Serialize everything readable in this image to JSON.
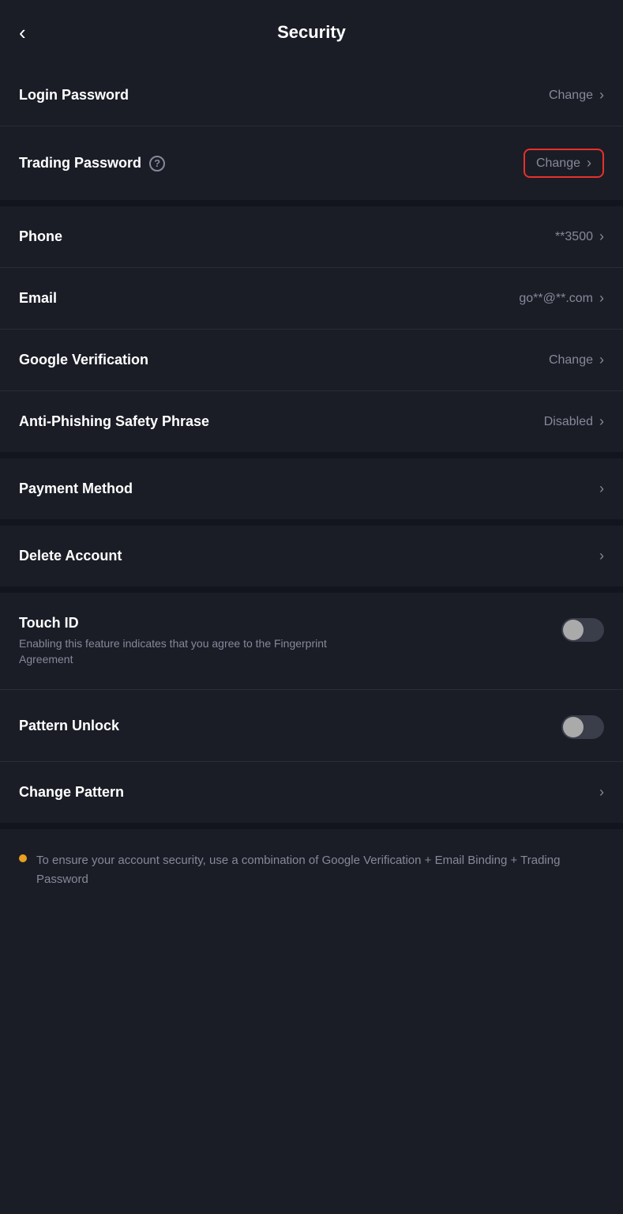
{
  "header": {
    "title": "Security",
    "back_label": "<"
  },
  "sections": {
    "passwords": [
      {
        "id": "login-password",
        "label": "Login Password",
        "action": "Change",
        "highlighted": false,
        "has_help": false
      },
      {
        "id": "trading-password",
        "label": "Trading Password",
        "action": "Change",
        "highlighted": true,
        "has_help": true
      }
    ],
    "account": [
      {
        "id": "phone",
        "label": "Phone",
        "value": "**3500",
        "has_help": false
      },
      {
        "id": "email",
        "label": "Email",
        "value": "go**@**.com",
        "has_help": false
      },
      {
        "id": "google-verification",
        "label": "Google Verification",
        "action": "Change",
        "has_help": false
      },
      {
        "id": "anti-phishing",
        "label": "Anti-Phishing Safety Phrase",
        "action": "Disabled",
        "has_help": false
      }
    ],
    "other": [
      {
        "id": "payment-method",
        "label": "Payment Method"
      },
      {
        "id": "delete-account",
        "label": "Delete Account"
      }
    ],
    "biometrics": {
      "touch_id": {
        "label": "Touch ID",
        "subtitle": "Enabling this feature indicates that you agree to the Fingerprint Agreement",
        "enabled": false
      },
      "pattern_unlock": {
        "label": "Pattern Unlock",
        "enabled": false
      },
      "change_pattern": {
        "label": "Change Pattern"
      }
    }
  },
  "footer": {
    "note": "To ensure your account security, use a combination of Google Verification + Email Binding + Trading Password"
  }
}
